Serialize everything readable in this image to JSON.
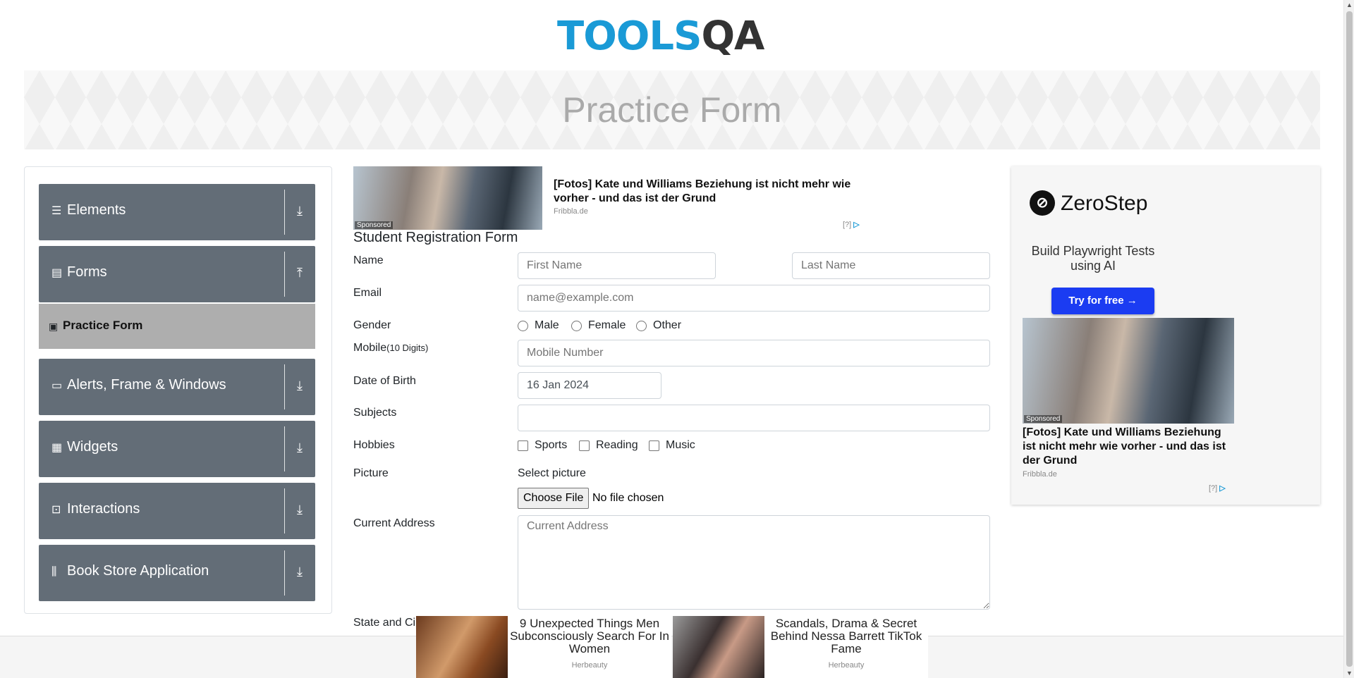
{
  "header": {
    "logo_main": "TOOLS",
    "logo_accent": "QA",
    "banner_title": "Practice Form"
  },
  "sidebar": {
    "groups": [
      {
        "label": "Elements",
        "icon": "list-icon",
        "arrow": "download-icon"
      },
      {
        "label": "Forms",
        "icon": "document-icon",
        "arrow": "upload-icon"
      },
      {
        "label": "Alerts, Frame & Windows",
        "icon": "window-icon",
        "arrow": "download-icon"
      },
      {
        "label": "Widgets",
        "icon": "grid-icon",
        "arrow": "download-icon"
      },
      {
        "label": "Interactions",
        "icon": "interaction-icon",
        "arrow": "download-icon"
      },
      {
        "label": "Book Store Application",
        "icon": "books-icon",
        "arrow": "download-icon"
      }
    ],
    "active_item": "Practice Form"
  },
  "top_ad": {
    "title": "[Fotos] Kate und Williams Beziehung ist nicht mehr wie vorher - und das ist der Grund",
    "source": "Fribbla.de",
    "sponsored": "Sponsored",
    "info": "[?]"
  },
  "form": {
    "title": "Student Registration Form",
    "name_label": "Name",
    "first_name_placeholder": "First Name",
    "last_name_placeholder": "Last Name",
    "email_label": "Email",
    "email_placeholder": "name@example.com",
    "gender_label": "Gender",
    "gender_options": [
      "Male",
      "Female",
      "Other"
    ],
    "mobile_label": "Mobile",
    "mobile_hint": "(10 Digits)",
    "mobile_placeholder": "Mobile Number",
    "dob_label": "Date of Birth",
    "dob_value": "16 Jan 2024",
    "subjects_label": "Subjects",
    "hobbies_label": "Hobbies",
    "hobby_options": [
      "Sports",
      "Reading",
      "Music"
    ],
    "picture_label": "Picture",
    "select_picture": "Select picture",
    "choose_file": "Choose File",
    "no_file": "No file chosen",
    "address_label": "Current Address",
    "address_placeholder": "Current Address",
    "state_label": "State and Ci"
  },
  "right_ad": {
    "brand": "ZeroStep",
    "tagline": "Build Playwright Tests using AI",
    "cta": "Try for free →",
    "sponsored": "Sponsored",
    "title": "[Fotos] Kate und Williams Beziehung ist nicht mehr wie vorher - und das ist der Grund",
    "source": "Fribbla.de",
    "info": "[?]"
  },
  "bottom_ads": [
    {
      "title": "9 Unexpected Things Men Subconsciously Search For In Women",
      "source": "Herbeauty"
    },
    {
      "title": "Scandals, Drama & Secret Behind Nessa Barrett TikTok Fame",
      "source": "Herbeauty"
    }
  ]
}
